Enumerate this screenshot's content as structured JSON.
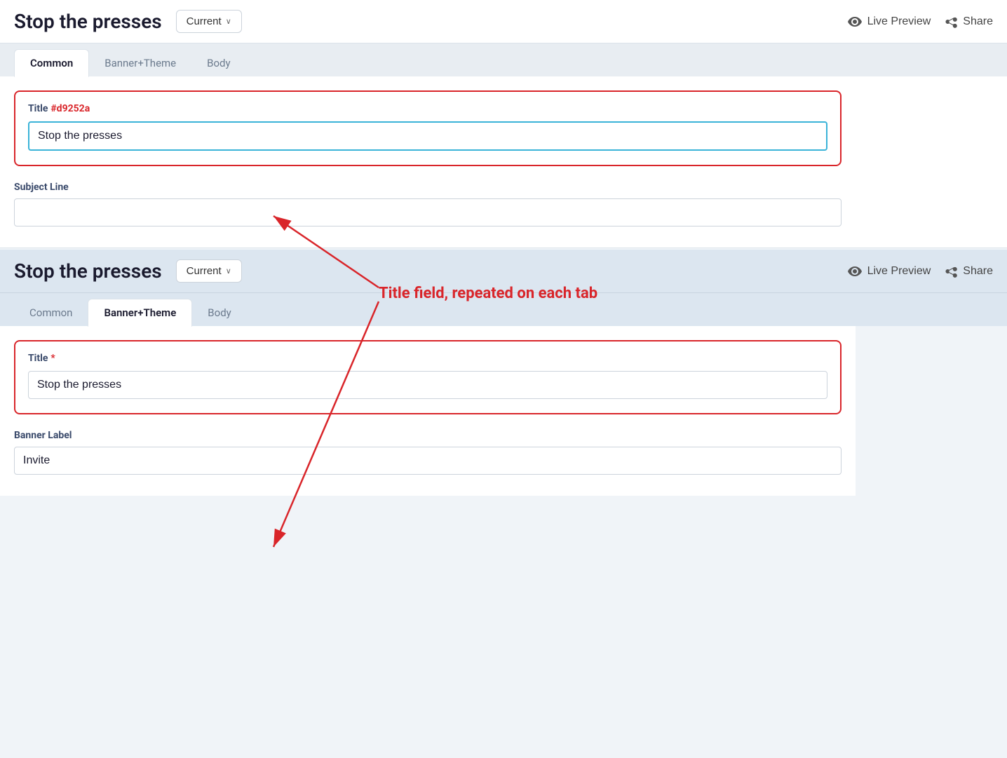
{
  "top": {
    "title": "Stop the presses",
    "current_btn": "Current",
    "chevron": "∨",
    "live_preview_label": "Live Preview",
    "share_label": "Share",
    "tabs": [
      {
        "id": "common",
        "label": "Common",
        "active": true
      },
      {
        "id": "banner-theme",
        "label": "Banner+Theme",
        "active": false
      },
      {
        "id": "body",
        "label": "Body",
        "active": false
      }
    ],
    "title_field": {
      "label": "Title",
      "required": true,
      "value": "Stop the presses"
    },
    "subject_line_field": {
      "label": "Subject Line",
      "value": ""
    }
  },
  "bottom": {
    "title": "Stop the presses",
    "current_btn": "Current",
    "chevron": "∨",
    "live_preview_label": "Live Preview",
    "share_label": "Share",
    "tabs": [
      {
        "id": "common",
        "label": "Common",
        "active": false
      },
      {
        "id": "banner-theme",
        "label": "Banner+Theme",
        "active": true
      },
      {
        "id": "body",
        "label": "Body",
        "active": false
      }
    ],
    "title_field": {
      "label": "Title",
      "required": true,
      "value": "Stop the presses"
    },
    "banner_label_field": {
      "label": "Banner Label",
      "value": "Invite"
    }
  },
  "annotation": {
    "text": "Title field, repeated on each tab",
    "color": "#d9252a"
  }
}
